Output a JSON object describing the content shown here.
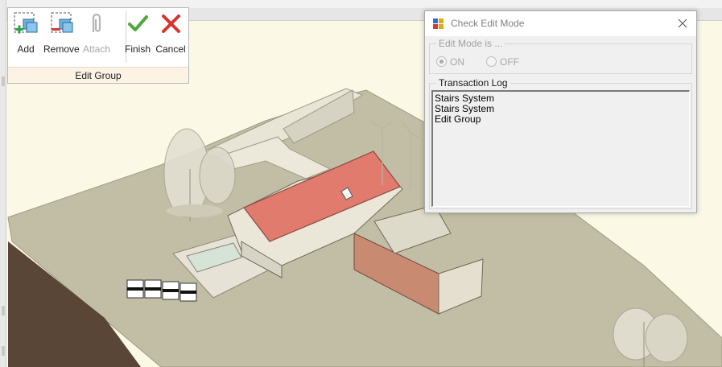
{
  "ribbon": {
    "panel_title": "Edit Group",
    "buttons": {
      "add": "Add",
      "remove": "Remove",
      "attach": "Attach",
      "finish": "Finish",
      "cancel": "Cancel"
    }
  },
  "dialog": {
    "title": "Check Edit Mode",
    "edit_mode": {
      "legend": "Edit Mode is ...",
      "options": [
        "ON",
        "OFF"
      ],
      "selected": "ON",
      "enabled": false
    },
    "transaction_log": {
      "legend": "Transaction Log",
      "entries": [
        "Stairs System",
        "Stairs System",
        "Edit Group"
      ]
    }
  },
  "colors": {
    "viewport_background": "#fbf8e6",
    "terrain": "#c2bea5",
    "roof": "#e07b6e",
    "cladding": "#c98a72",
    "ground_section": "#5a4637"
  }
}
